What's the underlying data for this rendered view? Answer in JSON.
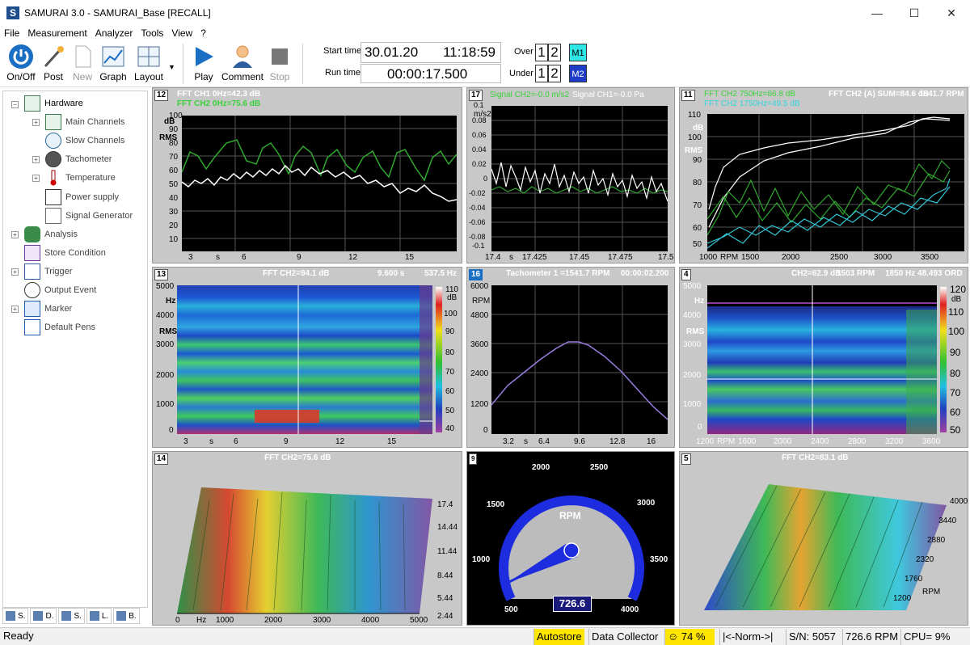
{
  "window": {
    "title": "SAMURAI 3.0 - SAMURAI_Base [RECALL]",
    "app_icon": "S",
    "minimize": "—",
    "maximize": "☐",
    "close": "✕"
  },
  "menu": [
    "File",
    "Measurement",
    "Analyzer",
    "Tools",
    "View",
    "?"
  ],
  "toolbar": {
    "onoff": "On/Off",
    "post": "Post",
    "new": "New",
    "graph": "Graph",
    "layout": "Layout",
    "play": "Play",
    "comment": "Comment",
    "stop": "Stop",
    "start_time_label": "Start time",
    "start_date": "30.01.20",
    "start_time": "11:18:59",
    "run_time_label": "Run time",
    "run_time": "00:00:17.500",
    "over_label": "Over",
    "under_label": "Under",
    "d1": "1",
    "d2": "2",
    "m1": "M1",
    "m2": "M2"
  },
  "tree": [
    "Hardware",
    "Main Channels",
    "Slow Channels",
    "Tachometer",
    "Temperature",
    "Power supply",
    "Signal Generator",
    "Analysis",
    "Store Condition",
    "Trigger",
    "Output Event",
    "Marker",
    "Default Pens"
  ],
  "sidetabs": [
    "S.",
    "D.",
    "S.",
    "L.",
    "B."
  ],
  "panels": {
    "p12": {
      "num": "12",
      "h1": "FFT CH1 0Hz=42.3 dB",
      "h2": "FFT CH2 0Hz=75.6 dB",
      "ylab": [
        "dB",
        "RMS"
      ],
      "yticks": [
        "100",
        "90",
        "80",
        "70",
        "60",
        "50",
        "40",
        "30",
        "20",
        "10"
      ],
      "xticks": [
        "3",
        "s",
        "6",
        "9",
        "12",
        "15"
      ]
    },
    "p17": {
      "num": "17",
      "h1": "Signal CH2=-0.0 m/s2",
      "h2": "Signal CH1=-0.0 Pa",
      "ylab": "m/s2",
      "yticks": [
        "0.1",
        "0.08",
        "0.06",
        "0.04",
        "0.02",
        "0",
        "-0.02",
        "-0.04",
        "-0.06",
        "-0.08",
        "-0.1"
      ],
      "xticks": [
        "17.4",
        "s",
        "17.425",
        "17.45",
        "17.475",
        "17.5"
      ]
    },
    "p11": {
      "num": "11",
      "h1": "FFT CH2 750Hz=66.8 dB",
      "h2": "FFT CH2 1750Hz=49.5 dB",
      "h3": "FFT CH2 (A) SUM=84.6 dB",
      "h3b": "1541.7 RPM",
      "ylab": [
        "dB",
        "RMS"
      ],
      "yticks": [
        "110",
        "100",
        "90",
        "80",
        "70",
        "60",
        "50"
      ],
      "xticks": [
        "1000",
        "RPM",
        "1500",
        "2000",
        "2500",
        "3000",
        "3500"
      ]
    },
    "p13": {
      "num": "13",
      "h1": "FFT CH2=94.1 dB",
      "h2": "9.600 s",
      "h3": "537.5 Hz",
      "ylab": [
        "Hz",
        "RMS"
      ],
      "yticks": [
        "5000",
        "4000",
        "3000",
        "2000",
        "1000",
        "0"
      ],
      "xticks": [
        "3",
        "s",
        "6",
        "9",
        "12",
        "15"
      ],
      "scale": [
        "110",
        "dB",
        "100",
        "90",
        "80",
        "70",
        "60",
        "50",
        "40"
      ]
    },
    "p16": {
      "num": "16",
      "h1": "Tachometer 1 =1541.7 RPM",
      "h2": "00:00:02.200",
      "ylab": "RPM",
      "yticks": [
        "6000",
        "4800",
        "3600",
        "2400",
        "1200",
        "0"
      ],
      "xticks": [
        "3.2",
        "s",
        "6.4",
        "9.6",
        "12.8",
        "16"
      ]
    },
    "p4": {
      "num": "4",
      "h1": "CH2=62.9 dB",
      "h1b": "1503 RPM",
      "h2": "1850 Hz 48.493 ORD",
      "ylab": [
        "Hz",
        "RMS"
      ],
      "yticks": [
        "5000",
        "4000",
        "3000",
        "2000",
        "1000",
        "0"
      ],
      "xticks": [
        "1200",
        "RPM",
        "1600",
        "2000",
        "2400",
        "2800",
        "3200",
        "3600"
      ],
      "scale": [
        "120",
        "dB",
        "110",
        "100",
        "90",
        "80",
        "70",
        "60",
        "50"
      ]
    },
    "p14": {
      "num": "14",
      "h1": "FFT CH2=75.6 dB",
      "xticks": [
        "0",
        "Hz",
        "1000",
        "2000",
        "3000",
        "4000",
        "5000"
      ],
      "zticks": [
        "17.4",
        "14.44",
        "11.44",
        "8.44",
        "5.44",
        "2.44"
      ]
    },
    "p9": {
      "num": "9",
      "label": "RPM",
      "value": "726.6",
      "ticks": [
        "500",
        "1000",
        "1500",
        "2000",
        "2500",
        "3000",
        "3500",
        "4000"
      ]
    },
    "p5": {
      "num": "5",
      "h1": "FFT CH2=83.1 dB",
      "zticks": [
        "4000",
        "3440",
        "2880",
        "2320",
        "1760",
        "RPM",
        "1200"
      ]
    }
  },
  "status": {
    "ready": "Ready",
    "autostore": "Autostore",
    "collector": "Data Collector",
    "pct": "☺ 74 %",
    "norm": "|<-Norm->|",
    "sn": "S/N: 5057",
    "rpm": "726.6 RPM",
    "cpu": "CPU=  9%"
  }
}
